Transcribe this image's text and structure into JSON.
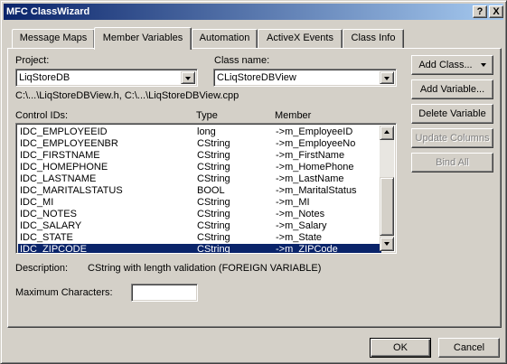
{
  "window": {
    "title": "MFC ClassWizard",
    "help_glyph": "?",
    "close_glyph": "X"
  },
  "tabs": [
    {
      "label": "Message Maps",
      "active": false
    },
    {
      "label": "Member Variables",
      "active": true
    },
    {
      "label": "Automation",
      "active": false
    },
    {
      "label": "ActiveX Events",
      "active": false
    },
    {
      "label": "Class Info",
      "active": false
    }
  ],
  "project": {
    "label": "Project:",
    "value": "LiqStoreDB"
  },
  "class_name": {
    "label": "Class name:",
    "value": "CLiqStoreDBView"
  },
  "files_path": "C:\\...\\LiqStoreDBView.h, C:\\...\\LiqStoreDBView.cpp",
  "list": {
    "headers": {
      "control_ids": "Control IDs:",
      "type": "Type",
      "member": "Member"
    },
    "rows": [
      {
        "id": "IDC_EMPLOYEEID",
        "type": "long",
        "member": "->m_EmployeeID",
        "selected": false
      },
      {
        "id": "IDC_EMPLOYEENBR",
        "type": "CString",
        "member": "->m_EmployeeNo",
        "selected": false
      },
      {
        "id": "IDC_FIRSTNAME",
        "type": "CString",
        "member": "->m_FirstName",
        "selected": false
      },
      {
        "id": "IDC_HOMEPHONE",
        "type": "CString",
        "member": "->m_HomePhone",
        "selected": false
      },
      {
        "id": "IDC_LASTNAME",
        "type": "CString",
        "member": "->m_LastName",
        "selected": false
      },
      {
        "id": "IDC_MARITALSTATUS",
        "type": "BOOL",
        "member": "->m_MaritalStatus",
        "selected": false
      },
      {
        "id": "IDC_MI",
        "type": "CString",
        "member": "->m_MI",
        "selected": false
      },
      {
        "id": "IDC_NOTES",
        "type": "CString",
        "member": "->m_Notes",
        "selected": false
      },
      {
        "id": "IDC_SALARY",
        "type": "CString",
        "member": "->m_Salary",
        "selected": false
      },
      {
        "id": "IDC_STATE",
        "type": "CString",
        "member": "->m_State",
        "selected": false
      },
      {
        "id": "IDC_ZIPCODE",
        "type": "CString",
        "member": "->m_ZIPCode",
        "selected": true
      }
    ]
  },
  "description": {
    "label": "Description:",
    "text": "CString with length validation (FOREIGN VARIABLE)"
  },
  "max_chars": {
    "label": "Maximum Characters:",
    "value": ""
  },
  "buttons": {
    "add_class": "Add Class...",
    "add_variable": "Add Variable...",
    "delete_variable": "Delete Variable",
    "update_columns": "Update Columns",
    "bind_all": "Bind All",
    "ok": "OK",
    "cancel": "Cancel"
  },
  "colors": {
    "title_bar": "#0a246a",
    "face": "#d4d0c8",
    "selection": "#0a246a"
  }
}
